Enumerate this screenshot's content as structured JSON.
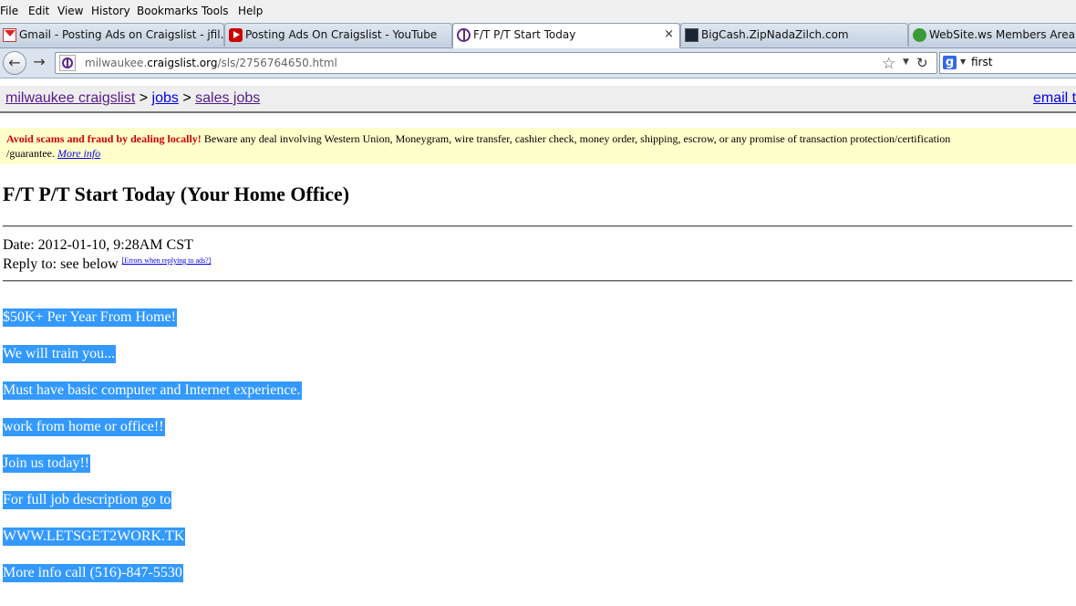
{
  "menu": [
    "File",
    "Edit",
    "View",
    "History",
    "Bookmarks",
    "Tools",
    "Help"
  ],
  "tabs": [
    {
      "title": "Gmail - Posting Ads on Craigslist - jfil...",
      "icon": "gmail-icon"
    },
    {
      "title": "Posting Ads On Craigslist - YouTube",
      "icon": "youtube-icon"
    },
    {
      "title": "F/T P/T Start Today",
      "icon": "peace-icon",
      "active": true
    },
    {
      "title": "BigCash.ZipNadaZilch.com",
      "icon": "bigcash-icon"
    },
    {
      "title": "WebSite.ws Members Area",
      "icon": "websitews-icon"
    }
  ],
  "tab_close": "×",
  "url": {
    "host_prefix": "milwaukee.",
    "host_domain": "craigslist.org",
    "path": "/sls/2756764650.html"
  },
  "search": {
    "value": "first"
  },
  "breadcrumb": {
    "site": "milwaukee craigslist",
    "sep": ">",
    "jobs": "jobs",
    "section": "sales jobs"
  },
  "email_link": "email t",
  "warning": {
    "bold": "Avoid scams and fraud by dealing locally!",
    "text1": " Beware any deal involving Western Union, Moneygram, wire transfer, cashier check, money order, shipping, escrow, or any promise of transaction protection/certification",
    "text2": "/guarantee. ",
    "more": "More info"
  },
  "post": {
    "title": "F/T P/T Start Today (Your Home Office)",
    "date": "Date: 2012-01-10, 9:28AM CST",
    "reply": "Reply to: see below ",
    "errors_link": "[Errors when replying to ads?]",
    "body": [
      "$50K+ Per Year From Home!",
      "We will train you...",
      "Must have basic computer and Internet experience.",
      "work from home or office!!",
      "Join us today!!",
      "For full job description go to",
      "WWW.LETSGET2WORK.TK",
      "More info call (516)-847-5530"
    ]
  },
  "colors": {
    "selection": "#3399ff",
    "warning_bg": "#ffffcc",
    "warning_red": "#cc0000",
    "visited_link": "#551a8b"
  }
}
